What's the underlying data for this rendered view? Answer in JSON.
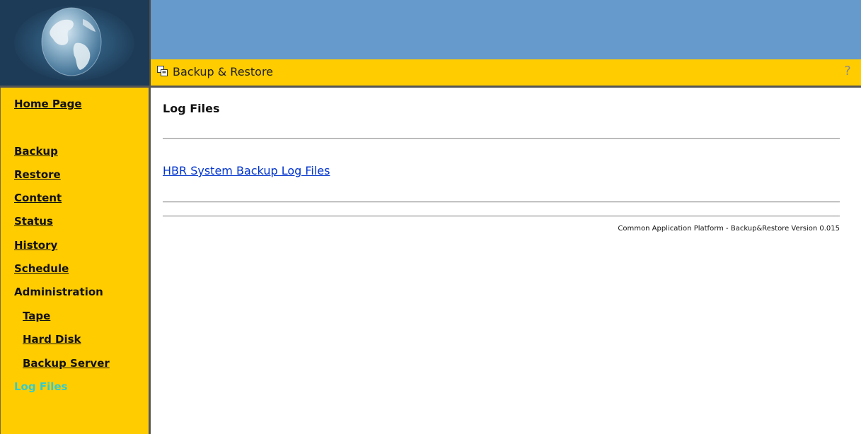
{
  "header": {
    "title": "Backup & Restore",
    "app_icon": "backup-restore-icon",
    "help_glyph": "?",
    "colors": {
      "header_blue": "#6699cc",
      "accent_yellow": "#ffcc00",
      "active_link": "#33cccc",
      "content_link": "#0033cc"
    }
  },
  "sidebar": {
    "home": "Home Page",
    "items": [
      {
        "label": "Backup"
      },
      {
        "label": "Restore"
      },
      {
        "label": "Content"
      },
      {
        "label": "Status"
      },
      {
        "label": "History"
      },
      {
        "label": "Schedule"
      }
    ],
    "administration": {
      "label": "Administration",
      "items": [
        {
          "label": "Tape"
        },
        {
          "label": "Hard Disk"
        },
        {
          "label": "Backup Server"
        }
      ]
    },
    "active": {
      "label": "Log Files"
    }
  },
  "main": {
    "heading": "Log Files",
    "links": [
      {
        "label": "HBR System Backup Log Files"
      }
    ],
    "footer": "Common Application Platform - Backup&Restore Version 0.015"
  }
}
